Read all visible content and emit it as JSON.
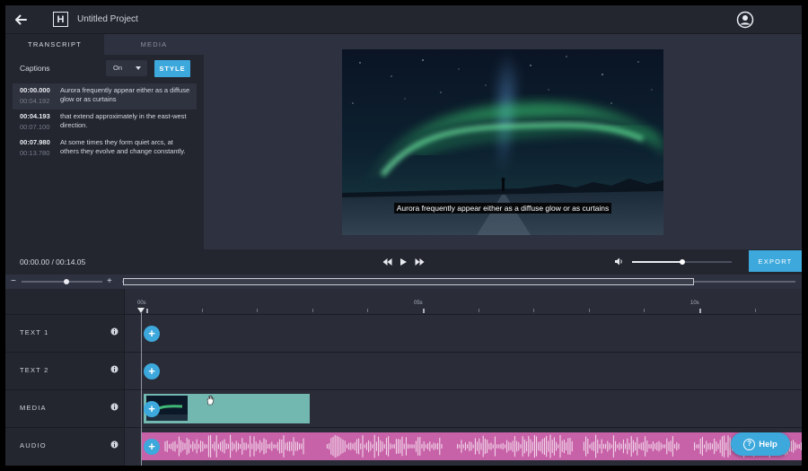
{
  "header": {
    "title": "Untitled Project",
    "logo_letter": "H"
  },
  "left_panel": {
    "tabs": [
      {
        "label": "TRANSCRIPT",
        "active": true
      },
      {
        "label": "MEDIA",
        "active": false
      }
    ],
    "captions_label": "Captions",
    "captions_value": "On",
    "style_label": "STYLE",
    "transcript": [
      {
        "start": "00:00.000",
        "end": "00:04.192",
        "text": "Aurora frequently appear either as a diffuse glow or as curtains",
        "selected": true
      },
      {
        "start": "00:04.193",
        "end": "00:07.100",
        "text": "that extend approximately in the east-west direction.",
        "selected": false
      },
      {
        "start": "00:07.980",
        "end": "00:13.780",
        "text": "At some times they form quiet arcs, at others they evolve and change constantly.",
        "selected": false
      }
    ]
  },
  "preview": {
    "caption": "Aurora frequently appear either as a diffuse glow or as curtains"
  },
  "transport": {
    "timecode": "00:00.00 / 00:14.05",
    "volume_level": 0.5,
    "export_label": "EXPORT"
  },
  "zoom": {
    "minus": "−",
    "plus": "+",
    "level": 0.55
  },
  "timeline": {
    "ruler_labels": [
      "00s",
      "05s",
      "10s"
    ],
    "tracks": [
      {
        "label": "TEXT 1",
        "kind": "text"
      },
      {
        "label": "TEXT 2",
        "kind": "text"
      },
      {
        "label": "MEDIA",
        "kind": "media"
      },
      {
        "label": "AUDIO",
        "kind": "audio"
      }
    ]
  },
  "help": {
    "label": "Help",
    "glyph": "?"
  },
  "colors": {
    "accent": "#3da8dc",
    "media_clip": "#73b7b1",
    "audio_clip": "#c862a8",
    "panel": "#23262f",
    "background": "#2e3240"
  },
  "icons": [
    "back-arrow-icon",
    "logo-icon",
    "user-avatar-icon",
    "caret-down-icon",
    "rewind-icon",
    "play-icon",
    "fast-forward-icon",
    "volume-icon",
    "info-icon",
    "plus-icon",
    "hand-cursor-icon",
    "help-icon"
  ]
}
